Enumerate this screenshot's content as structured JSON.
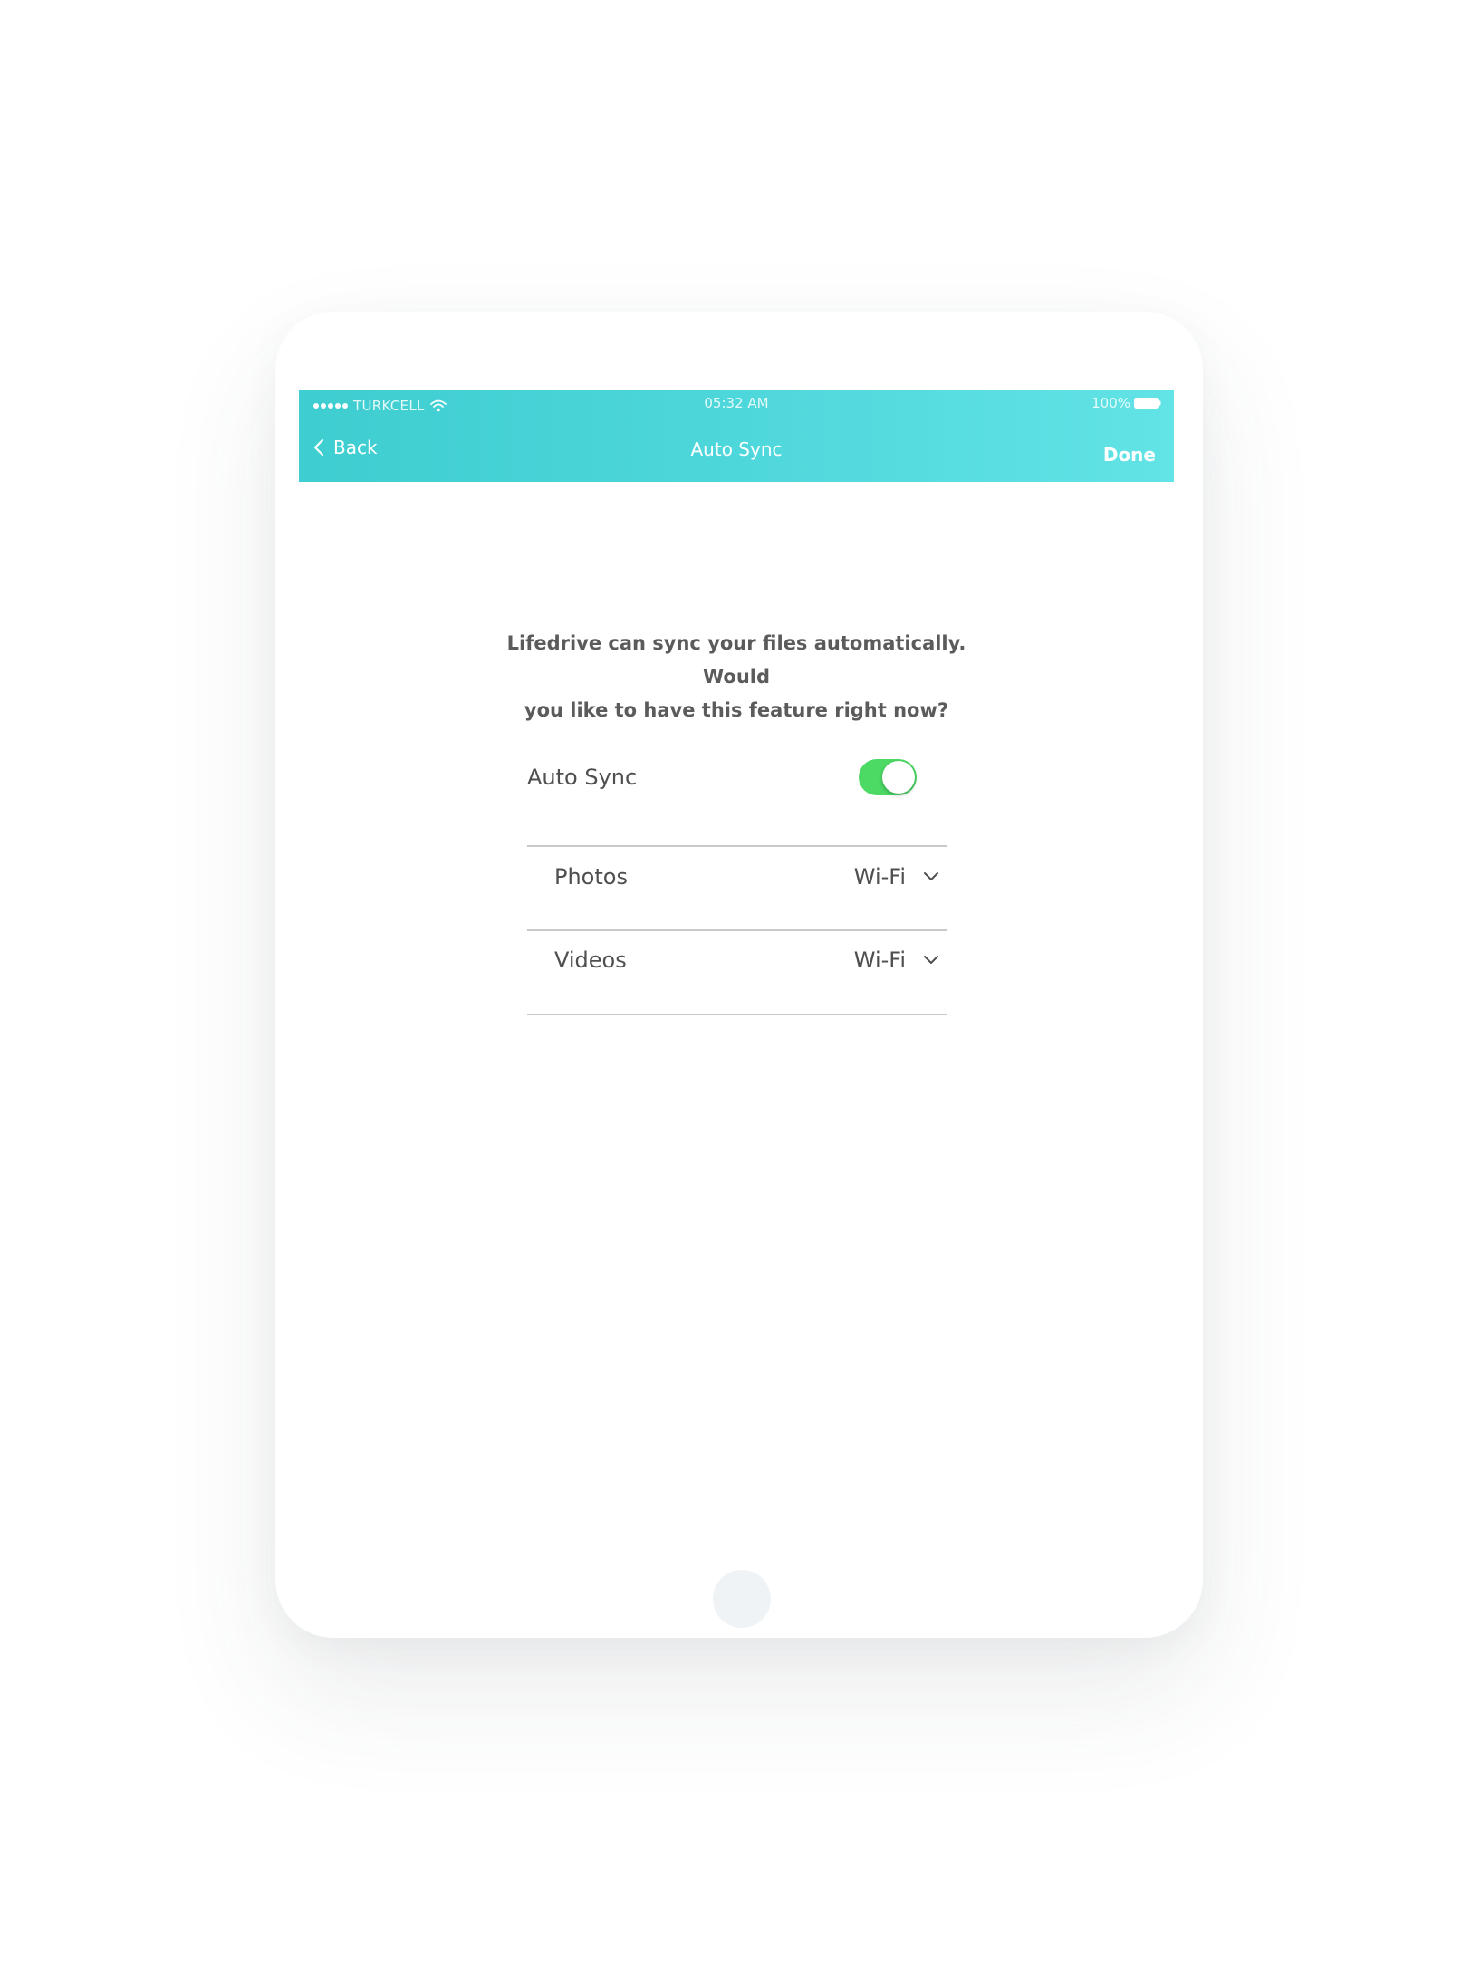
{
  "status_bar": {
    "carrier": "TURKCELL",
    "time": "05:32 AM",
    "battery": "100%"
  },
  "nav": {
    "back_label": "Back",
    "title": "Auto Sync",
    "done_label": "Done"
  },
  "intro": {
    "line1": "Lifedrive can sync your files automatically. Would",
    "line2": "you like to have this feature right now?"
  },
  "auto_sync": {
    "label": "Auto Sync",
    "enabled": true
  },
  "preferences": [
    {
      "label": "Photos",
      "value": "Wi-Fi"
    },
    {
      "label": "Videos",
      "value": "Wi-Fi"
    }
  ],
  "colors": {
    "header_start": "#3ecdd0",
    "header_end": "#62e3e5",
    "toggle_on": "#4cd964",
    "text": "#4f4f4f"
  }
}
